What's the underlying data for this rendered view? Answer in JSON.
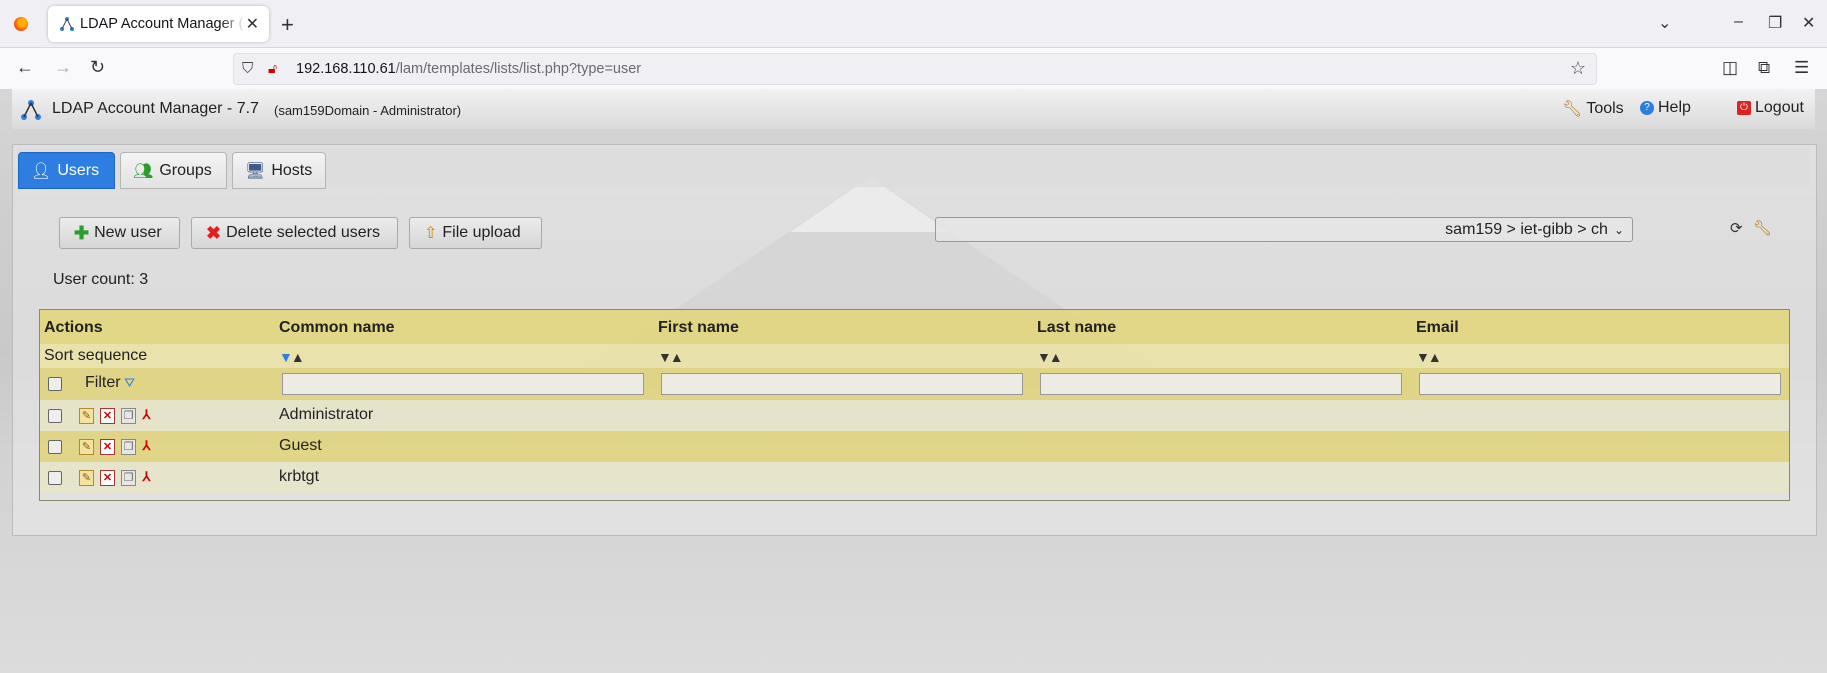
{
  "browser": {
    "tab_title": "LDAP Account Manager (",
    "new_tab": "+",
    "url_host": "192.168.110.61",
    "url_path": "/lam/templates/lists/list.php?type=user"
  },
  "header": {
    "title": "LDAP Account Manager - 7.7",
    "subtitle": "(sam159Domain - Administrator)",
    "tools_label": "Tools",
    "help_label": "Help",
    "logout_label": "Logout"
  },
  "type_tabs": [
    {
      "label": "Users",
      "active": true
    },
    {
      "label": "Groups",
      "active": false
    },
    {
      "label": "Hosts",
      "active": false
    }
  ],
  "toolbar": {
    "new_user_label": "New user",
    "delete_label": "Delete selected users",
    "upload_label": "File upload",
    "ou_selected": "sam159 > iet-gibb > ch"
  },
  "user_count": "User count: 3",
  "table": {
    "columns": [
      "Actions",
      "Common name",
      "First name",
      "Last name",
      "Email"
    ],
    "sort_label": "Sort sequence",
    "filter_label": "Filter",
    "rows": [
      {
        "common_name": "Administrator",
        "first_name": "",
        "last_name": "",
        "email": ""
      },
      {
        "common_name": "Guest",
        "first_name": "",
        "last_name": "",
        "email": ""
      },
      {
        "common_name": "krbtgt",
        "first_name": "",
        "last_name": "",
        "email": ""
      }
    ]
  },
  "colors": {
    "active_tab": "#2e7de1",
    "table_header": "#e2d678",
    "table_row_alt": "#e0d478"
  }
}
